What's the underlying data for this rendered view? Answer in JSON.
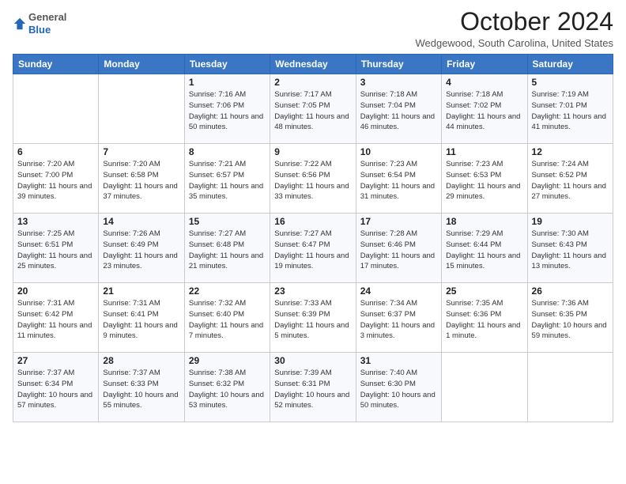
{
  "header": {
    "logo": {
      "general": "General",
      "blue": "Blue"
    },
    "title": "October 2024",
    "location": "Wedgewood, South Carolina, United States"
  },
  "calendar": {
    "days_of_week": [
      "Sunday",
      "Monday",
      "Tuesday",
      "Wednesday",
      "Thursday",
      "Friday",
      "Saturday"
    ],
    "weeks": [
      [
        {
          "day": "",
          "sunrise": "",
          "sunset": "",
          "daylight": ""
        },
        {
          "day": "",
          "sunrise": "",
          "sunset": "",
          "daylight": ""
        },
        {
          "day": "1",
          "sunrise": "Sunrise: 7:16 AM",
          "sunset": "Sunset: 7:06 PM",
          "daylight": "Daylight: 11 hours and 50 minutes."
        },
        {
          "day": "2",
          "sunrise": "Sunrise: 7:17 AM",
          "sunset": "Sunset: 7:05 PM",
          "daylight": "Daylight: 11 hours and 48 minutes."
        },
        {
          "day": "3",
          "sunrise": "Sunrise: 7:18 AM",
          "sunset": "Sunset: 7:04 PM",
          "daylight": "Daylight: 11 hours and 46 minutes."
        },
        {
          "day": "4",
          "sunrise": "Sunrise: 7:18 AM",
          "sunset": "Sunset: 7:02 PM",
          "daylight": "Daylight: 11 hours and 44 minutes."
        },
        {
          "day": "5",
          "sunrise": "Sunrise: 7:19 AM",
          "sunset": "Sunset: 7:01 PM",
          "daylight": "Daylight: 11 hours and 41 minutes."
        }
      ],
      [
        {
          "day": "6",
          "sunrise": "Sunrise: 7:20 AM",
          "sunset": "Sunset: 7:00 PM",
          "daylight": "Daylight: 11 hours and 39 minutes."
        },
        {
          "day": "7",
          "sunrise": "Sunrise: 7:20 AM",
          "sunset": "Sunset: 6:58 PM",
          "daylight": "Daylight: 11 hours and 37 minutes."
        },
        {
          "day": "8",
          "sunrise": "Sunrise: 7:21 AM",
          "sunset": "Sunset: 6:57 PM",
          "daylight": "Daylight: 11 hours and 35 minutes."
        },
        {
          "day": "9",
          "sunrise": "Sunrise: 7:22 AM",
          "sunset": "Sunset: 6:56 PM",
          "daylight": "Daylight: 11 hours and 33 minutes."
        },
        {
          "day": "10",
          "sunrise": "Sunrise: 7:23 AM",
          "sunset": "Sunset: 6:54 PM",
          "daylight": "Daylight: 11 hours and 31 minutes."
        },
        {
          "day": "11",
          "sunrise": "Sunrise: 7:23 AM",
          "sunset": "Sunset: 6:53 PM",
          "daylight": "Daylight: 11 hours and 29 minutes."
        },
        {
          "day": "12",
          "sunrise": "Sunrise: 7:24 AM",
          "sunset": "Sunset: 6:52 PM",
          "daylight": "Daylight: 11 hours and 27 minutes."
        }
      ],
      [
        {
          "day": "13",
          "sunrise": "Sunrise: 7:25 AM",
          "sunset": "Sunset: 6:51 PM",
          "daylight": "Daylight: 11 hours and 25 minutes."
        },
        {
          "day": "14",
          "sunrise": "Sunrise: 7:26 AM",
          "sunset": "Sunset: 6:49 PM",
          "daylight": "Daylight: 11 hours and 23 minutes."
        },
        {
          "day": "15",
          "sunrise": "Sunrise: 7:27 AM",
          "sunset": "Sunset: 6:48 PM",
          "daylight": "Daylight: 11 hours and 21 minutes."
        },
        {
          "day": "16",
          "sunrise": "Sunrise: 7:27 AM",
          "sunset": "Sunset: 6:47 PM",
          "daylight": "Daylight: 11 hours and 19 minutes."
        },
        {
          "day": "17",
          "sunrise": "Sunrise: 7:28 AM",
          "sunset": "Sunset: 6:46 PM",
          "daylight": "Daylight: 11 hours and 17 minutes."
        },
        {
          "day": "18",
          "sunrise": "Sunrise: 7:29 AM",
          "sunset": "Sunset: 6:44 PM",
          "daylight": "Daylight: 11 hours and 15 minutes."
        },
        {
          "day": "19",
          "sunrise": "Sunrise: 7:30 AM",
          "sunset": "Sunset: 6:43 PM",
          "daylight": "Daylight: 11 hours and 13 minutes."
        }
      ],
      [
        {
          "day": "20",
          "sunrise": "Sunrise: 7:31 AM",
          "sunset": "Sunset: 6:42 PM",
          "daylight": "Daylight: 11 hours and 11 minutes."
        },
        {
          "day": "21",
          "sunrise": "Sunrise: 7:31 AM",
          "sunset": "Sunset: 6:41 PM",
          "daylight": "Daylight: 11 hours and 9 minutes."
        },
        {
          "day": "22",
          "sunrise": "Sunrise: 7:32 AM",
          "sunset": "Sunset: 6:40 PM",
          "daylight": "Daylight: 11 hours and 7 minutes."
        },
        {
          "day": "23",
          "sunrise": "Sunrise: 7:33 AM",
          "sunset": "Sunset: 6:39 PM",
          "daylight": "Daylight: 11 hours and 5 minutes."
        },
        {
          "day": "24",
          "sunrise": "Sunrise: 7:34 AM",
          "sunset": "Sunset: 6:37 PM",
          "daylight": "Daylight: 11 hours and 3 minutes."
        },
        {
          "day": "25",
          "sunrise": "Sunrise: 7:35 AM",
          "sunset": "Sunset: 6:36 PM",
          "daylight": "Daylight: 11 hours and 1 minute."
        },
        {
          "day": "26",
          "sunrise": "Sunrise: 7:36 AM",
          "sunset": "Sunset: 6:35 PM",
          "daylight": "Daylight: 10 hours and 59 minutes."
        }
      ],
      [
        {
          "day": "27",
          "sunrise": "Sunrise: 7:37 AM",
          "sunset": "Sunset: 6:34 PM",
          "daylight": "Daylight: 10 hours and 57 minutes."
        },
        {
          "day": "28",
          "sunrise": "Sunrise: 7:37 AM",
          "sunset": "Sunset: 6:33 PM",
          "daylight": "Daylight: 10 hours and 55 minutes."
        },
        {
          "day": "29",
          "sunrise": "Sunrise: 7:38 AM",
          "sunset": "Sunset: 6:32 PM",
          "daylight": "Daylight: 10 hours and 53 minutes."
        },
        {
          "day": "30",
          "sunrise": "Sunrise: 7:39 AM",
          "sunset": "Sunset: 6:31 PM",
          "daylight": "Daylight: 10 hours and 52 minutes."
        },
        {
          "day": "31",
          "sunrise": "Sunrise: 7:40 AM",
          "sunset": "Sunset: 6:30 PM",
          "daylight": "Daylight: 10 hours and 50 minutes."
        },
        {
          "day": "",
          "sunrise": "",
          "sunset": "",
          "daylight": ""
        },
        {
          "day": "",
          "sunrise": "",
          "sunset": "",
          "daylight": ""
        }
      ]
    ]
  }
}
